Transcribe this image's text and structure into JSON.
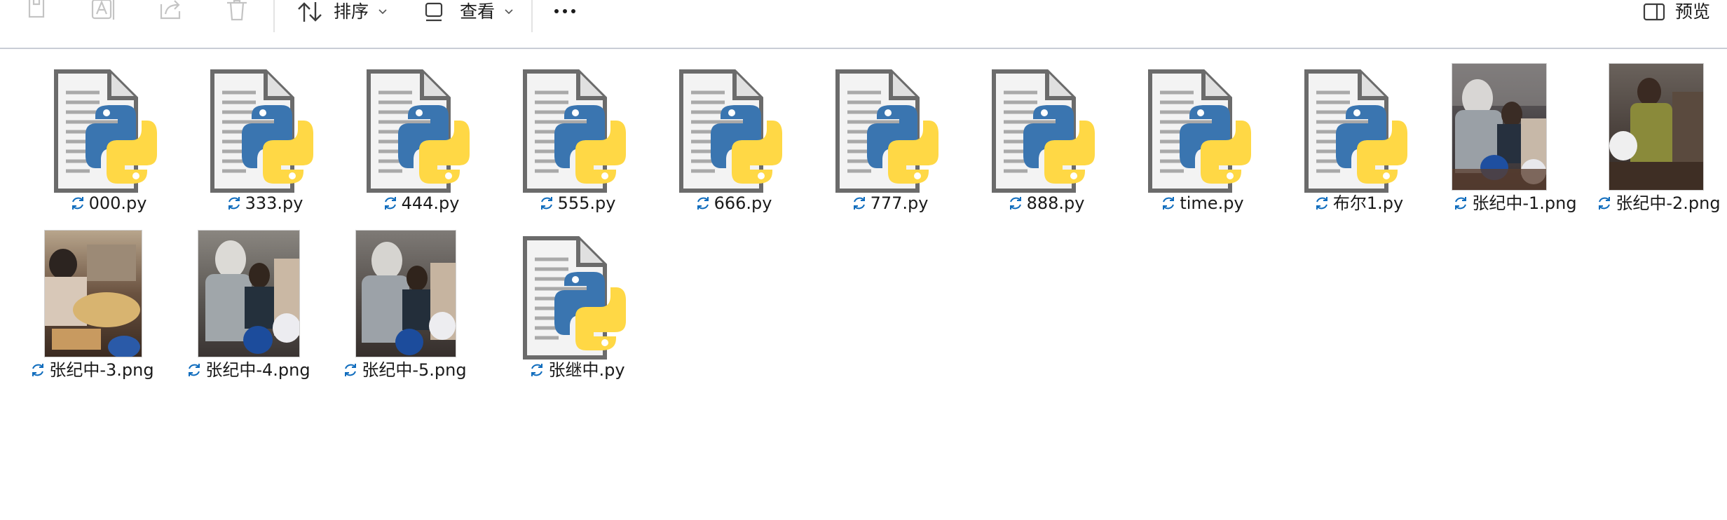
{
  "toolbar": {
    "icons": {
      "copy": "copy-icon",
      "rename": "rename-icon",
      "share": "share-icon",
      "delete": "trash-icon",
      "sort": "sort-icon",
      "view": "view-icon",
      "more": "more-icon",
      "preview": "preview-pane-icon"
    },
    "sort_label": "排序",
    "view_label": "查看",
    "preview_label": "预览"
  },
  "colors": {
    "sync_blue": "#0f6cbd",
    "python_blue": "#3a75b0",
    "python_yellow": "#ffd845",
    "doc_gray": "#6b6b6b"
  },
  "files": [
    {
      "name": "000.py",
      "type": "python",
      "status_icon": "sync-icon"
    },
    {
      "name": "333.py",
      "type": "python",
      "status_icon": "sync-icon"
    },
    {
      "name": "444.py",
      "type": "python",
      "status_icon": "sync-icon"
    },
    {
      "name": "555.py",
      "type": "python",
      "status_icon": "sync-icon"
    },
    {
      "name": "666.py",
      "type": "python",
      "status_icon": "sync-icon"
    },
    {
      "name": "777.py",
      "type": "python",
      "status_icon": "sync-icon"
    },
    {
      "name": "888.py",
      "type": "python",
      "status_icon": "sync-icon"
    },
    {
      "name": "time.py",
      "type": "python",
      "status_icon": "sync-icon"
    },
    {
      "name": "布尔1.py",
      "type": "python",
      "status_icon": "sync-icon"
    },
    {
      "name": "张纪中-1.png",
      "type": "image",
      "status_icon": "sync-icon"
    },
    {
      "name": "张纪中-2.png",
      "type": "image",
      "status_icon": "sync-icon"
    },
    {
      "name": "张纪中-3.png",
      "type": "image",
      "status_icon": "sync-icon"
    },
    {
      "name": "张纪中-4.png",
      "type": "image",
      "status_icon": "sync-icon"
    },
    {
      "name": "张纪中-5.png",
      "type": "image",
      "status_icon": "sync-icon"
    },
    {
      "name": "张继中.py",
      "type": "python",
      "status_icon": "sync-icon"
    }
  ]
}
